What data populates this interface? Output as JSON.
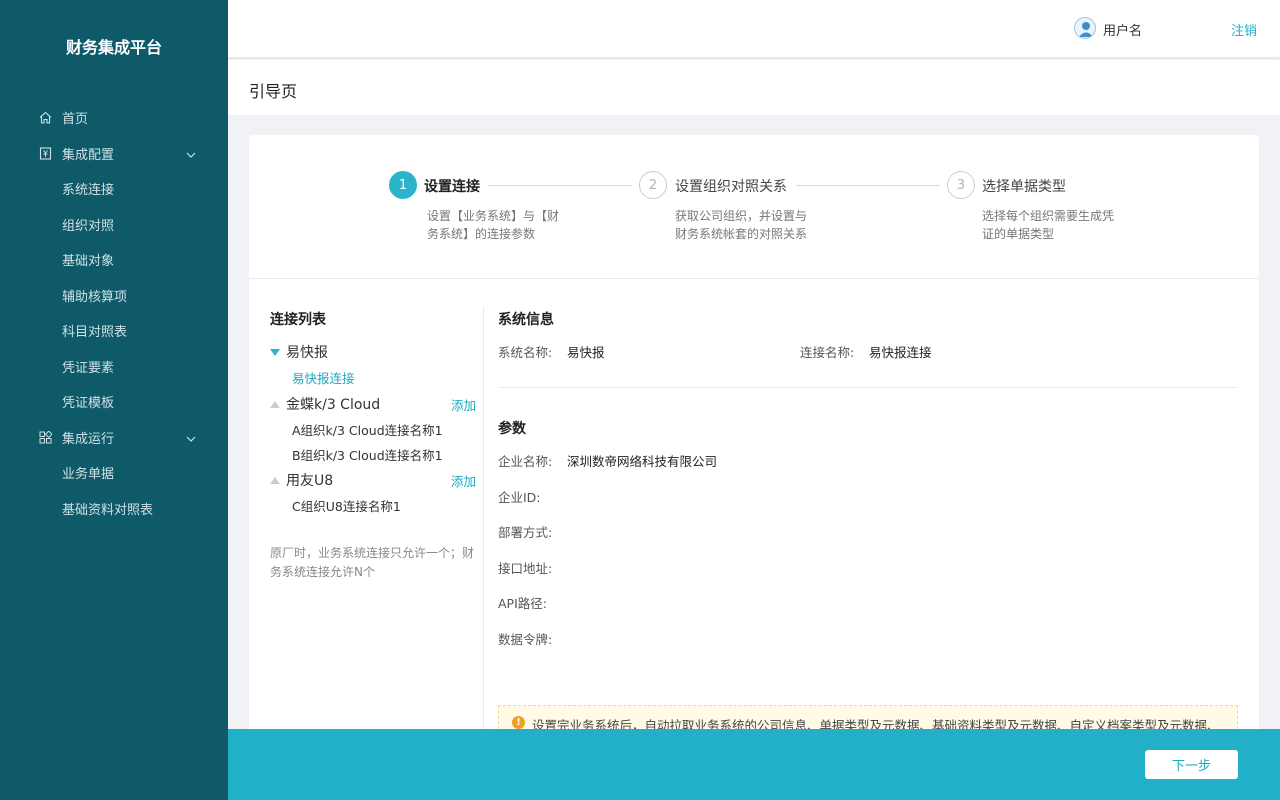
{
  "app": {
    "title": "财务集成平台"
  },
  "sidebar": {
    "items": [
      {
        "label": "首页",
        "icon": "home-icon"
      },
      {
        "label": "集成配置",
        "icon": "yen-doc-icon",
        "expanded": true
      },
      {
        "label": "系统连接"
      },
      {
        "label": "组织对照"
      },
      {
        "label": "基础对象"
      },
      {
        "label": "辅助核算项"
      },
      {
        "label": "科目对照表"
      },
      {
        "label": "凭证要素"
      },
      {
        "label": "凭证模板"
      },
      {
        "label": "集成运行",
        "icon": "apps-icon",
        "expanded": true
      },
      {
        "label": "业务单据"
      },
      {
        "label": "基础资料对照表"
      }
    ]
  },
  "header": {
    "username": "用户名",
    "logout": "注销"
  },
  "page": {
    "title": "引导页"
  },
  "steps": [
    {
      "num": "1",
      "title": "设置连接",
      "desc1": "设置【业务系统】与【财",
      "desc2": "务系统】的连接参数",
      "active": true
    },
    {
      "num": "2",
      "title": "设置组织对照关系",
      "desc1": "获取公司组织，并设置与",
      "desc2": "财务系统帐套的对照关系"
    },
    {
      "num": "3",
      "title": "选择单据类型",
      "desc1": "选择每个组织需要生成凭",
      "desc2": "证的单据类型"
    }
  ],
  "connections": {
    "title": "连接列表",
    "add_label": "添加",
    "groups": [
      {
        "name": "易快报",
        "children": [
          "易快报连接"
        ]
      },
      {
        "name": "金蝶k/3 Cloud",
        "children": [
          "A组织k/3 Cloud连接名称1",
          "B组织k/3 Cloud连接名称1"
        ]
      },
      {
        "name": "用友U8",
        "children": [
          "C组织U8连接名称1"
        ]
      }
    ],
    "note": "原厂时，业务系统连接只允许一个；财务系统连接允许N个"
  },
  "system_info": {
    "title": "系统信息",
    "system_name_label": "系统名称:",
    "system_name": "易快报",
    "connection_name_label": "连接名称:",
    "connection_name": "易快报连接"
  },
  "params": {
    "title": "参数",
    "company_name_label": "企业名称:",
    "company_name": "深圳数帝网络科技有限公司",
    "company_id_label": "企业ID:",
    "deploy_label": "部署方式:",
    "endpoint_label": "接口地址:",
    "api_path_label": "API路径:",
    "token_label": "数据令牌:"
  },
  "warning": "设置完业务系统后，自动拉取业务系统的公司信息、单据类型及元数据、基础资料类型及元数据、自定义档案类型及元数据、",
  "footer": {
    "next": "下一步"
  },
  "colors": {
    "sidebar": "#0e5a69",
    "accent": "#22b0c9"
  }
}
